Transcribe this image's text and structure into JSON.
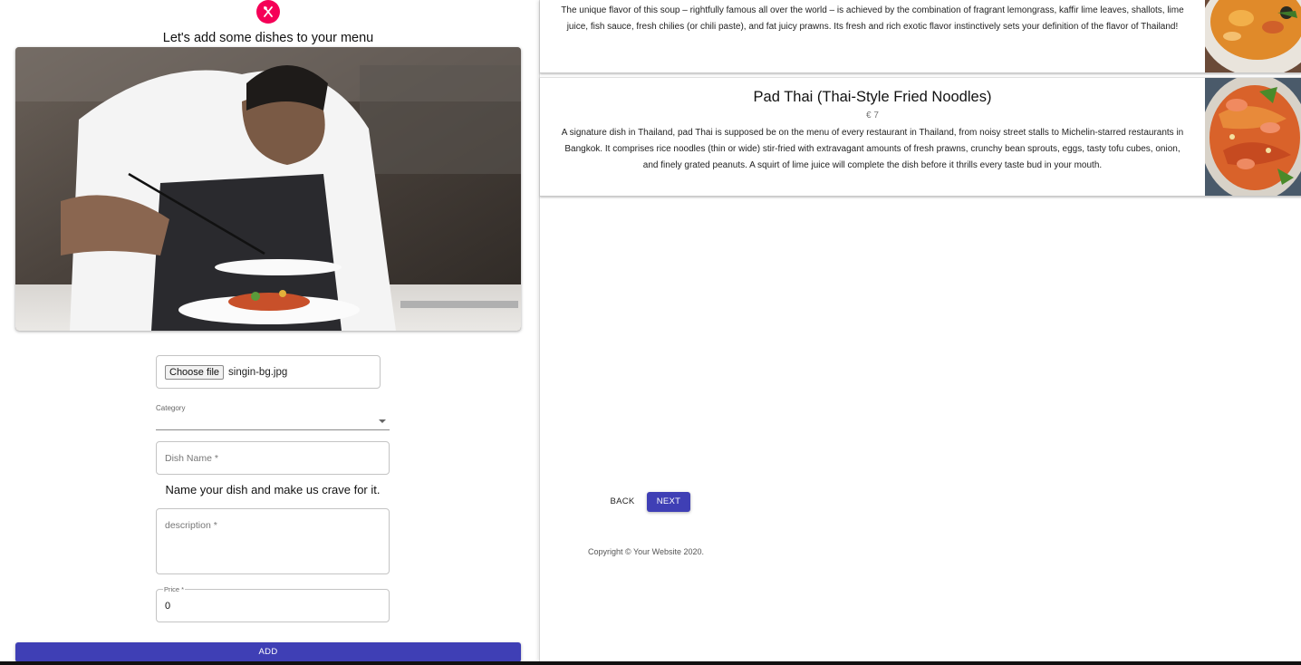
{
  "form": {
    "heading": "Let's add some dishes to your menu",
    "file": {
      "button_label": "Choose file",
      "file_name": "singin-bg.jpg"
    },
    "category": {
      "label": "Category",
      "value": ""
    },
    "dish_name": {
      "placeholder": "Dish Name *"
    },
    "hint": "Name your dish and make us crave for it.",
    "description": {
      "placeholder": "description *"
    },
    "price": {
      "label": "Price *",
      "value": "0"
    },
    "add_label": "ADD"
  },
  "menu": {
    "items": [
      {
        "title": "",
        "price": "",
        "description": "The unique flavor of this soup – rightfully famous all over the world – is achieved by the combination of fragrant lemongrass, kaffir lime leaves, shallots, lime juice, fish sauce, fresh chilies (or chili paste), and fat juicy prawns. Its fresh and rich exotic flavor instinctively sets your definition of the flavor of Thailand!",
        "image": "soup-photo"
      },
      {
        "title": "Pad Thai (Thai-Style Fried Noodles)",
        "price": "€ 7",
        "description": "A signature dish in Thailand, pad Thai is supposed be on the menu of every restaurant in Thailand, from noisy street stalls to Michelin-starred restaurants in Bangkok. It comprises rice noodles (thin or wide) stir-fried with extravagant amounts of fresh prawns, crunchy bean sprouts, eggs, tasty tofu cubes, onion, and finely grated peanuts. A squirt of lime juice will complete the dish before it thrills every taste bud in your mouth.",
        "image": "pad-thai-photo"
      }
    ]
  },
  "nav": {
    "back_label": "BACK",
    "next_label": "NEXT"
  },
  "footer": {
    "copyright": "Copyright © Your Website 2020."
  },
  "colors": {
    "primary": "#3f3fb5",
    "accent": "#f50057"
  },
  "icons": {
    "logo": "cutlery-icon",
    "select_arrow": "chevron-down-icon"
  }
}
